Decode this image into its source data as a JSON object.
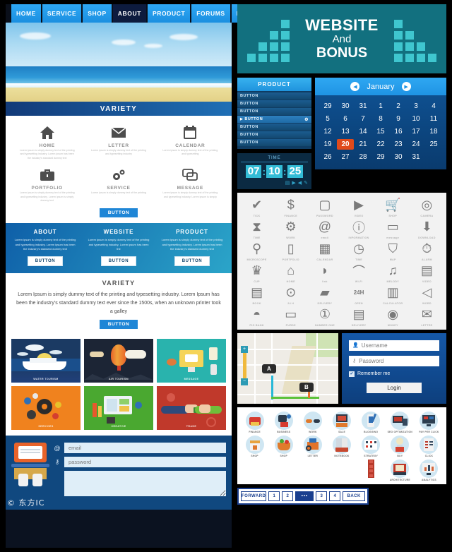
{
  "left": {
    "nav": [
      {
        "label": "HOME",
        "active": false
      },
      {
        "label": "SERVICE",
        "active": false
      },
      {
        "label": "SHOP",
        "active": false
      },
      {
        "label": "ABOUT",
        "active": true
      },
      {
        "label": "PRODUCT",
        "active": false
      },
      {
        "label": "FORUMS",
        "active": false
      },
      {
        "label": "BLOG",
        "active": false
      }
    ],
    "variety_title": "VARIETY",
    "features": [
      {
        "label": "HOME",
        "icon": "house-icon",
        "text": "Lorem ipsum is simply dummy text of the printing and typesetting industry. Lorem ipsum has been the industry's standard dummy text"
      },
      {
        "label": "LETTER",
        "icon": "envelope-icon",
        "text": "Lorem ipsum is simply dummy text of the printing and typesetting industry"
      },
      {
        "label": "CALENDAR",
        "icon": "calendar-icon",
        "text": "Lorem ipsum is simply dummy text of the printing and typesetting"
      },
      {
        "label": "PORTFOLIO",
        "icon": "briefcase-icon",
        "text": "Lorem ipsum is simply dummy text of the printing and typesetting industry. Lorem ipsum is simply dummy text"
      },
      {
        "label": "SERVICE",
        "icon": "gears-icon",
        "text": "Lorem ipsum is simply dummy text of the printing"
      },
      {
        "label": "MESSAGE",
        "icon": "speech-bubble-icon",
        "text": "Lorem ipsum is simply dummy text of the printing and typesetting industry. Lorem ipsum is simply"
      }
    ],
    "feature_button": "BUTTON",
    "columns": [
      {
        "title": "ABOUT",
        "text": "Lorem ipsum is simply dummy text of the printing and typesetting industry. Lorem ipsum has been the industry's standard dummy text",
        "button": "BUTTON"
      },
      {
        "title": "WEBSITE",
        "text": "Lorem ipsum is simply dummy text of the printing and typesetting industry. Lorem ipsum has been the",
        "button": "BUTTON"
      },
      {
        "title": "PRODUCT",
        "text": "Lorem ipsum is simply dummy text of the printing and typesetting industry. Lorem ipsum has been the industry's standard dummy text",
        "button": "BUTTON"
      }
    ],
    "variety2": {
      "title": "VARIETY",
      "text": "Lorem Ipsum is simply dummy text of the printing and typesetting industry. Lorem Ipsum has been the industry's standard dummy text ever since the 1500s, when an unknown printer took a galley",
      "button": "BUTTON"
    },
    "tiles": [
      {
        "label": "WATER TOURISM",
        "kind": "cruise"
      },
      {
        "label": "AIR TOURISM",
        "kind": "balloon"
      },
      {
        "label": "MESSAGE",
        "kind": "message"
      },
      {
        "label": "SERVICES",
        "kind": "services"
      },
      {
        "label": "CREATIVE",
        "kind": "creative"
      },
      {
        "label": "TRADE",
        "kind": "trade"
      }
    ],
    "form": {
      "email_placeholder": "email",
      "password_placeholder": "password",
      "email_icon": "at-icon",
      "password_icon": "key-icon",
      "message_value": ""
    },
    "watermark": "© 东方IC"
  },
  "right": {
    "banner": {
      "line1": "WEBSITE",
      "line2": "And",
      "line3": "BONUS",
      "bg": "#12707f",
      "bar": "#3fc6cf"
    },
    "product": {
      "title": "PRODUCT",
      "items": [
        "BUTTON",
        "BUTTON",
        "BUTTON",
        "BUTTON",
        "BUTTON",
        "BUTTON",
        "BUTTON"
      ],
      "active_index": 3
    },
    "time": {
      "title": "TIME",
      "hours": "07",
      "minutes": "10",
      "seconds": "25",
      "separator": ":",
      "controls": [
        "calendar-icon",
        "play-icon",
        "rewind-icon",
        "wrench-icon"
      ]
    },
    "calendar": {
      "month": "January",
      "prev_icon": "chevron-left-icon",
      "next_icon": "chevron-right-icon",
      "selected": 20,
      "weeks": [
        [
          "29",
          "30",
          "31",
          "1",
          "2",
          "3",
          "4"
        ],
        [
          "5",
          "6",
          "7",
          "8",
          "9",
          "10",
          "11"
        ],
        [
          "12",
          "13",
          "14",
          "15",
          "16",
          "17",
          "18"
        ],
        [
          "19",
          "20",
          "21",
          "22",
          "23",
          "24",
          "25"
        ],
        [
          "26",
          "27",
          "28",
          "29",
          "30",
          "31",
          ""
        ]
      ],
      "selected_color": "#e04a1b"
    },
    "icon_grid": [
      {
        "label": "TICK",
        "glyph": "✔",
        "name": "tick-icon"
      },
      {
        "label": "FINANCE",
        "glyph": "$",
        "name": "dollar-icon"
      },
      {
        "label": "PASSWORD",
        "glyph": "🔒",
        "name": "padlock-icon"
      },
      {
        "label": "VIDEO",
        "glyph": "▶",
        "name": "video-play-icon"
      },
      {
        "label": "SHOP",
        "glyph": "🛒",
        "name": "shopping-cart-icon"
      },
      {
        "label": "CAMERA",
        "glyph": "◎",
        "name": "camera-icon"
      },
      {
        "label": "TIME",
        "glyph": "⧖",
        "name": "hourglass-icon"
      },
      {
        "label": "WORK",
        "glyph": "⚙",
        "name": "gears-icon"
      },
      {
        "label": "email",
        "glyph": "@",
        "name": "at-icon"
      },
      {
        "label": "INFORMATION",
        "glyph": "i",
        "name": "info-icon"
      },
      {
        "label": "message",
        "glyph": "💬",
        "name": "speech-bubble-icon"
      },
      {
        "label": "DOWNLOAD",
        "glyph": "⬇",
        "name": "download-icon"
      },
      {
        "label": "MICROSCOPE",
        "glyph": "🔬",
        "name": "microscope-icon"
      },
      {
        "label": "PORTFOLIO",
        "glyph": "💼",
        "name": "briefcase-icon"
      },
      {
        "label": "CALENDAR",
        "glyph": "▦",
        "name": "calendar-icon"
      },
      {
        "label": "TIME",
        "glyph": "◷",
        "name": "clock-icon"
      },
      {
        "label": "MAP",
        "glyph": "🗺",
        "name": "map-icon"
      },
      {
        "label": "ALARM",
        "glyph": "⏰",
        "name": "alarm-clock-icon"
      },
      {
        "label": "CUP",
        "glyph": "🏆",
        "name": "trophy-icon"
      },
      {
        "label": "HOME",
        "glyph": "⌂",
        "name": "house-icon"
      },
      {
        "label": "link",
        "glyph": "📡",
        "name": "satellite-dish-icon"
      },
      {
        "label": "Wi-Fi",
        "glyph": "📶",
        "name": "wifi-icon"
      },
      {
        "label": "MELODY",
        "glyph": "♫",
        "name": "music-note-icon"
      },
      {
        "label": "VIDEO",
        "glyph": "▤",
        "name": "media-player-icon"
      },
      {
        "label": "BOOK",
        "glyph": "📖",
        "name": "open-book-icon"
      },
      {
        "label": "24 H",
        "glyph": "⌚",
        "name": "wristwatch-icon"
      },
      {
        "label": "DELIVERY",
        "glyph": "📦",
        "name": "parcel-icon"
      },
      {
        "label": "OPEN",
        "glyph": "24H",
        "name": "24h-open-icon"
      },
      {
        "label": "CALCULATOR",
        "glyph": "🖩",
        "name": "calculator-icon"
      },
      {
        "label": "WORD",
        "glyph": "📣",
        "name": "megaphone-icon"
      },
      {
        "label": "PIG BANK",
        "glyph": "🐷",
        "name": "piggy-bank-icon"
      },
      {
        "label": "PURSE",
        "glyph": "👛",
        "name": "purse-icon"
      },
      {
        "label": "NUMBER ONE",
        "glyph": "🥇",
        "name": "medal-icon"
      },
      {
        "label": "DELIVERY",
        "glyph": "🚚",
        "name": "delivery-truck-icon"
      },
      {
        "label": "MONEY",
        "glyph": "💰",
        "name": "money-icon"
      },
      {
        "label": "LETTER",
        "glyph": "✉",
        "name": "envelope-icon"
      }
    ],
    "map": {
      "pin_a": "A",
      "pin_b": "B",
      "zoom_in": "+",
      "zoom_out": "−"
    },
    "login": {
      "username_placeholder": "Username",
      "password_placeholder": "Password",
      "username_icon": "user-icon",
      "password_icon": "key-icon",
      "remember_label": "Remember me",
      "remember_checked": true,
      "login_button": "Login"
    },
    "circle_icons": [
      {
        "label": "FINANCE",
        "color": "#d63b2f"
      },
      {
        "label": "BUSINESS",
        "color": "#2b3a4a"
      },
      {
        "label": "WORK",
        "color": "#e0792c"
      },
      {
        "label": "SALE",
        "color": "#d34b36"
      },
      {
        "label": "BLOGGING",
        "color": "#2f6fb5"
      },
      {
        "label": "SEO OPTIMIZATION",
        "color": "#c0392b"
      },
      {
        "label": "PAY PER CLICK",
        "color": "#2c3e50"
      },
      {
        "label": "SHOP",
        "color": "#e8a33d"
      },
      {
        "label": "SHOP",
        "color": "#e07b2c"
      },
      {
        "label": "LETTER",
        "color": "#e2742b"
      },
      {
        "label": "NOTEBOOK",
        "color": "#c7482f"
      },
      {
        "label": "STRATEGY",
        "color": "#34495e"
      },
      {
        "label": "BUY",
        "color": "#d44332"
      },
      {
        "label": "CLICK",
        "color": "#b73a2a"
      },
      {
        "label": "ARCHITECTURE",
        "color": "#c0392b"
      },
      {
        "label": "ANALYTICS",
        "color": "#d4663a"
      }
    ],
    "pagination": {
      "forward": "FORWARD",
      "pages": [
        "1",
        "2"
      ],
      "dots": "•••",
      "pages2": [
        "3",
        "4"
      ],
      "back": "BACK"
    }
  }
}
